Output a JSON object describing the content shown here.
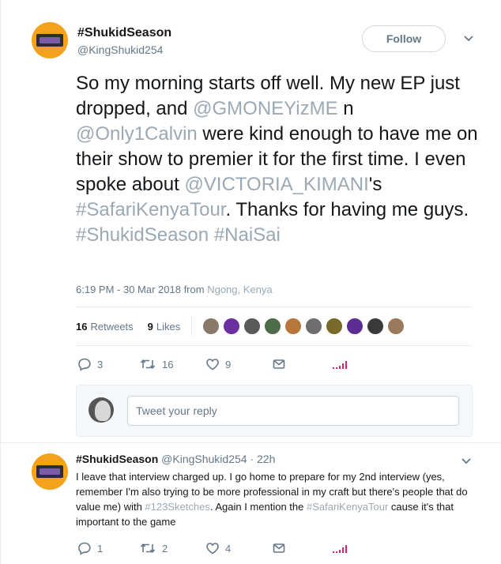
{
  "main_tweet": {
    "display_name": "#ShukidSeason",
    "handle": "@KingShukid254",
    "follow_label": "Follow",
    "text": {
      "p1": "So my morning starts off well. My new EP just dropped, and ",
      "m1": "@GMONEYizME",
      "p2": " n ",
      "m2": "@Only1Calvin",
      "p3": " were kind enough to have me on their show to premier it for the first time. I even spoke about ",
      "m3": "@VICTORIA_KIMANI",
      "p4": "'s ",
      "h1": "#SafariKenyaTour",
      "p5": ". Thanks for having me guys. ",
      "h2": "#ShukidSeason",
      "h3": "#NaiSai"
    },
    "timestamp": "6:19 PM - 30 Mar 2018 from",
    "location": "Ngong, Kenya",
    "retweets_count": "16",
    "retweets_label": "Retweets",
    "likes_count": "9",
    "likes_label": "Likes",
    "liker_colors": [
      "#8a7a6a",
      "#6b2fa0",
      "#5a5a5a",
      "#4e6b4a",
      "#b7773a",
      "#6e6e6e",
      "#7a6a2a",
      "#5b2d91",
      "#3a3a3a",
      "#9a7a5a"
    ],
    "actions": {
      "replies": "3",
      "retweets": "16",
      "likes": "9"
    }
  },
  "reply_box": {
    "placeholder": "Tweet your reply"
  },
  "reply_tweet": {
    "display_name": "#ShukidSeason",
    "handle_time": "@KingShukid254 · 22h",
    "text": {
      "p1": "I leave that interview charged up. I go home to prepare for my 2nd interview (yes, remember I'm also trying to be more professional in my craft but there's people that do value me) with ",
      "h1": "#123Sketches",
      "p2": ". Again I mention the ",
      "h2": "#SafariKenyaTour",
      "p3": " cause it's that important to the game"
    },
    "actions": {
      "replies": "1",
      "retweets": "2",
      "likes": "4"
    }
  },
  "colors": {
    "link": "#9ba9b4",
    "muted": "#657786",
    "analytics": "#e0245e"
  }
}
